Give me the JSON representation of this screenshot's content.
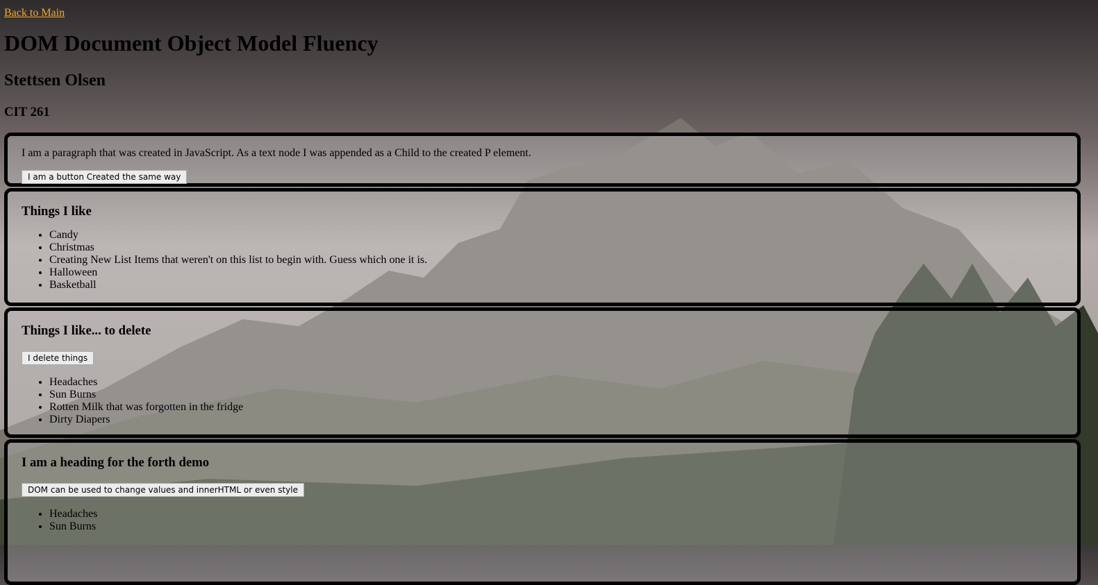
{
  "nav": {
    "back_link": "Back to Main"
  },
  "header": {
    "title": "DOM Document Object Model Fluency",
    "author": "Stettsen Olsen",
    "course": "CIT 261"
  },
  "demo1": {
    "paragraph": "I am a paragraph that was created in JavaScript. As a text node I was appended as a Child to the created P element.",
    "button_label": "I am a button Created the same way"
  },
  "demo2": {
    "heading": "Things I like",
    "items": [
      "Candy",
      "Christmas",
      "Creating New List Items that weren't on this list to begin with. Guess which one it is.",
      "Halloween",
      "Basketball"
    ]
  },
  "demo3": {
    "heading": "Things I like... to delete",
    "button_label": "I delete things",
    "items": [
      "Headaches",
      "Sun Burns",
      "Rotten Milk that was forgotten in the fridge",
      "Dirty Diapers"
    ]
  },
  "demo4": {
    "heading": "I am a heading for the forth demo",
    "button_label": "DOM can be used to change values and innerHTML or even style",
    "items": [
      "Headaches",
      "Sun Burns"
    ]
  },
  "colors": {
    "link": "#f5a81c",
    "border": "#000000"
  }
}
